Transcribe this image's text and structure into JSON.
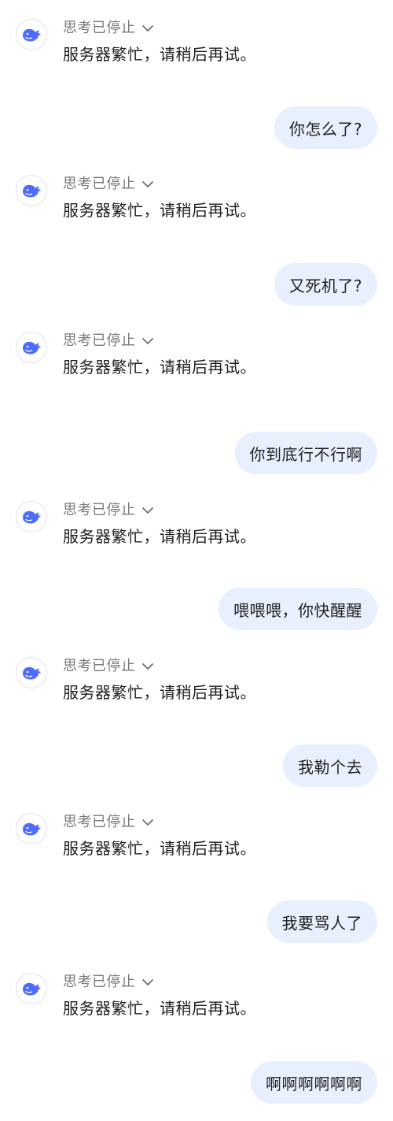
{
  "conversation": [
    {
      "role": "assistant",
      "thought_label": "思考已停止",
      "text": "服务器繁忙，请稍后再试。"
    },
    {
      "role": "user",
      "text": "你怎么了?"
    },
    {
      "role": "assistant",
      "thought_label": "思考已停止",
      "text": "服务器繁忙，请稍后再试。"
    },
    {
      "role": "user",
      "text": "又死机了?"
    },
    {
      "role": "assistant",
      "thought_label": "思考已停止",
      "text": "服务器繁忙，请稍后再试。"
    },
    {
      "role": "user",
      "text": "你到底行不行啊"
    },
    {
      "role": "assistant",
      "thought_label": "思考已停止",
      "text": "服务器繁忙，请稍后再试。"
    },
    {
      "role": "user",
      "text": "喂喂喂，你快醒醒"
    },
    {
      "role": "assistant",
      "thought_label": "思考已停止",
      "text": "服务器繁忙，请稍后再试。"
    },
    {
      "role": "user",
      "text": "我勒个去"
    },
    {
      "role": "assistant",
      "thought_label": "思考已停止",
      "text": "服务器繁忙，请稍后再试。"
    },
    {
      "role": "user",
      "text": "我要骂人了"
    },
    {
      "role": "assistant",
      "thought_label": "思考已停止",
      "text": "服务器繁忙，请稍后再试。"
    },
    {
      "role": "user",
      "text": "啊啊啊啊啊啊"
    }
  ],
  "icons": {
    "avatar": "whale-logo-icon",
    "thought_toggle": "chevron-down-icon"
  },
  "colors": {
    "user_bubble": "#e8f0fe",
    "logo_blue": "#4d6bfe",
    "muted_text": "#7a7a7a",
    "body_text": "#1f1f1f"
  }
}
